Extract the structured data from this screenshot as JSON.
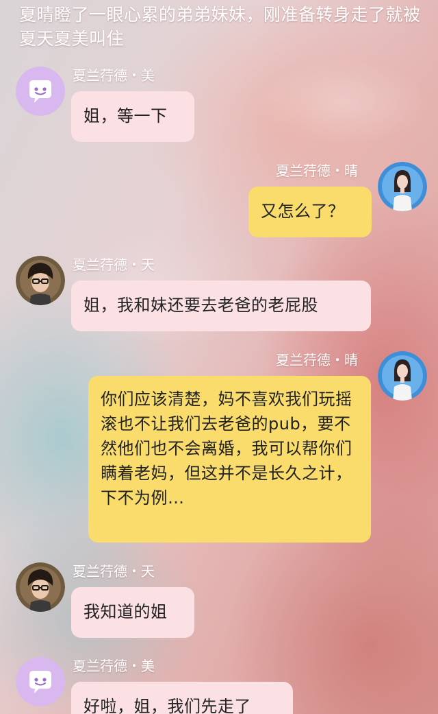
{
  "narration": "夏晴瞪了一眼心累的弟弟妹妹，刚准备转身走了就被夏天夏美叫住",
  "colors": {
    "left_bubble": "#fbe0e4",
    "right_bubble": "#f9dc6c",
    "name_text": "#ffffff",
    "bubble_text": "#222222",
    "avatar_mei_bg": "#d9b8f0"
  },
  "messages": [
    {
      "side": "left",
      "sender": "夏兰荇德・美",
      "avatar_icon": "chat-bubble-face-icon",
      "text": "姐，等一下"
    },
    {
      "side": "right",
      "sender": "夏兰荇德・晴",
      "avatar_icon": "woman-photo-avatar",
      "text": "又怎么了？"
    },
    {
      "side": "left",
      "sender": "夏兰荇德・天",
      "avatar_icon": "man-with-glasses-photo-avatar",
      "text": "姐，我和妹还要去老爸的老屁股"
    },
    {
      "side": "right",
      "sender": "夏兰荇德・晴",
      "avatar_icon": "woman-photo-avatar",
      "text": "你们应该清楚，妈不喜欢我们玩摇滚也不让我们去老爸的pub，要不然他们也不会离婚，我可以帮你们瞒着老妈，但这并不是长久之计，下不为例…"
    },
    {
      "side": "left",
      "sender": "夏兰荇德・天",
      "avatar_icon": "man-with-glasses-photo-avatar",
      "text": "我知道的姐"
    },
    {
      "side": "left",
      "sender": "夏兰荇德・美",
      "avatar_icon": "chat-bubble-face-icon",
      "text": "好啦，姐，我们先走了"
    }
  ]
}
